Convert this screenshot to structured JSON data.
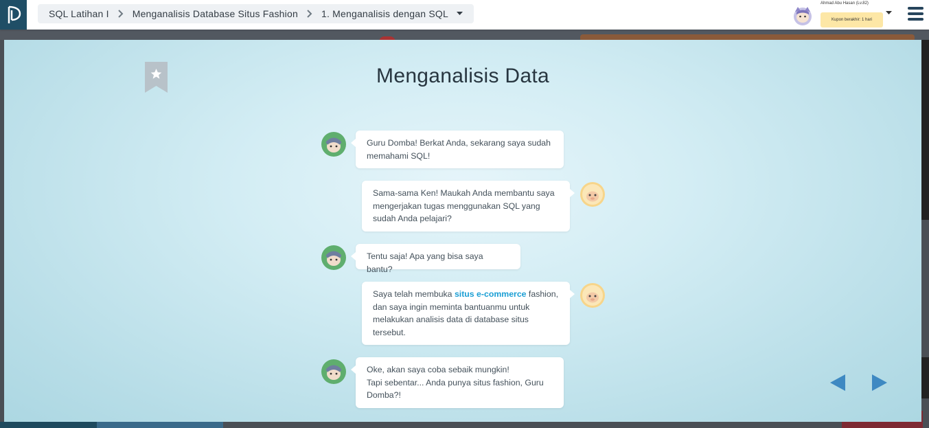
{
  "header": {
    "breadcrumb": [
      {
        "label": "SQL Latihan I"
      },
      {
        "label": "Menganalisis Database Situs Fashion"
      },
      {
        "label": "1. Menganalisis dengan SQL"
      }
    ],
    "user": {
      "name": "Ahmad Abu Hasan (Lv.82)",
      "coupon": "Kupon berakhir: 1 hari"
    }
  },
  "slide": {
    "title": "Menganalisis Data",
    "messages": [
      {
        "speaker": "ken",
        "side": "left",
        "text": "Guru Domba! Berkat Anda, sekarang saya sudah memahami SQL!"
      },
      {
        "speaker": "guru",
        "side": "right",
        "text": "Sama-sama Ken!  Maukah Anda membantu saya mengerjakan tugas menggunakan SQL yang sudah Anda pelajari?"
      },
      {
        "speaker": "ken",
        "side": "left",
        "text": "Tentu saja! Apa yang bisa saya bantu?"
      },
      {
        "speaker": "guru",
        "side": "right",
        "text_before": "Saya telah membuka ",
        "highlight": "situs e-commerce",
        "text_after": " fashion, dan saya ingin meminta bantuanmu untuk melakukan analisis data di database situs tersebut."
      },
      {
        "speaker": "ken",
        "side": "left",
        "line1": "Oke, akan saya coba sebaik mungkin!",
        "line2": "Tapi sebentar... Anda punya situs fashion, Guru Domba?!"
      }
    ]
  },
  "colors": {
    "accent": "#1a9ed4",
    "nav_arrow": "#3e89c2",
    "logo_bg": "#1f4e66"
  }
}
